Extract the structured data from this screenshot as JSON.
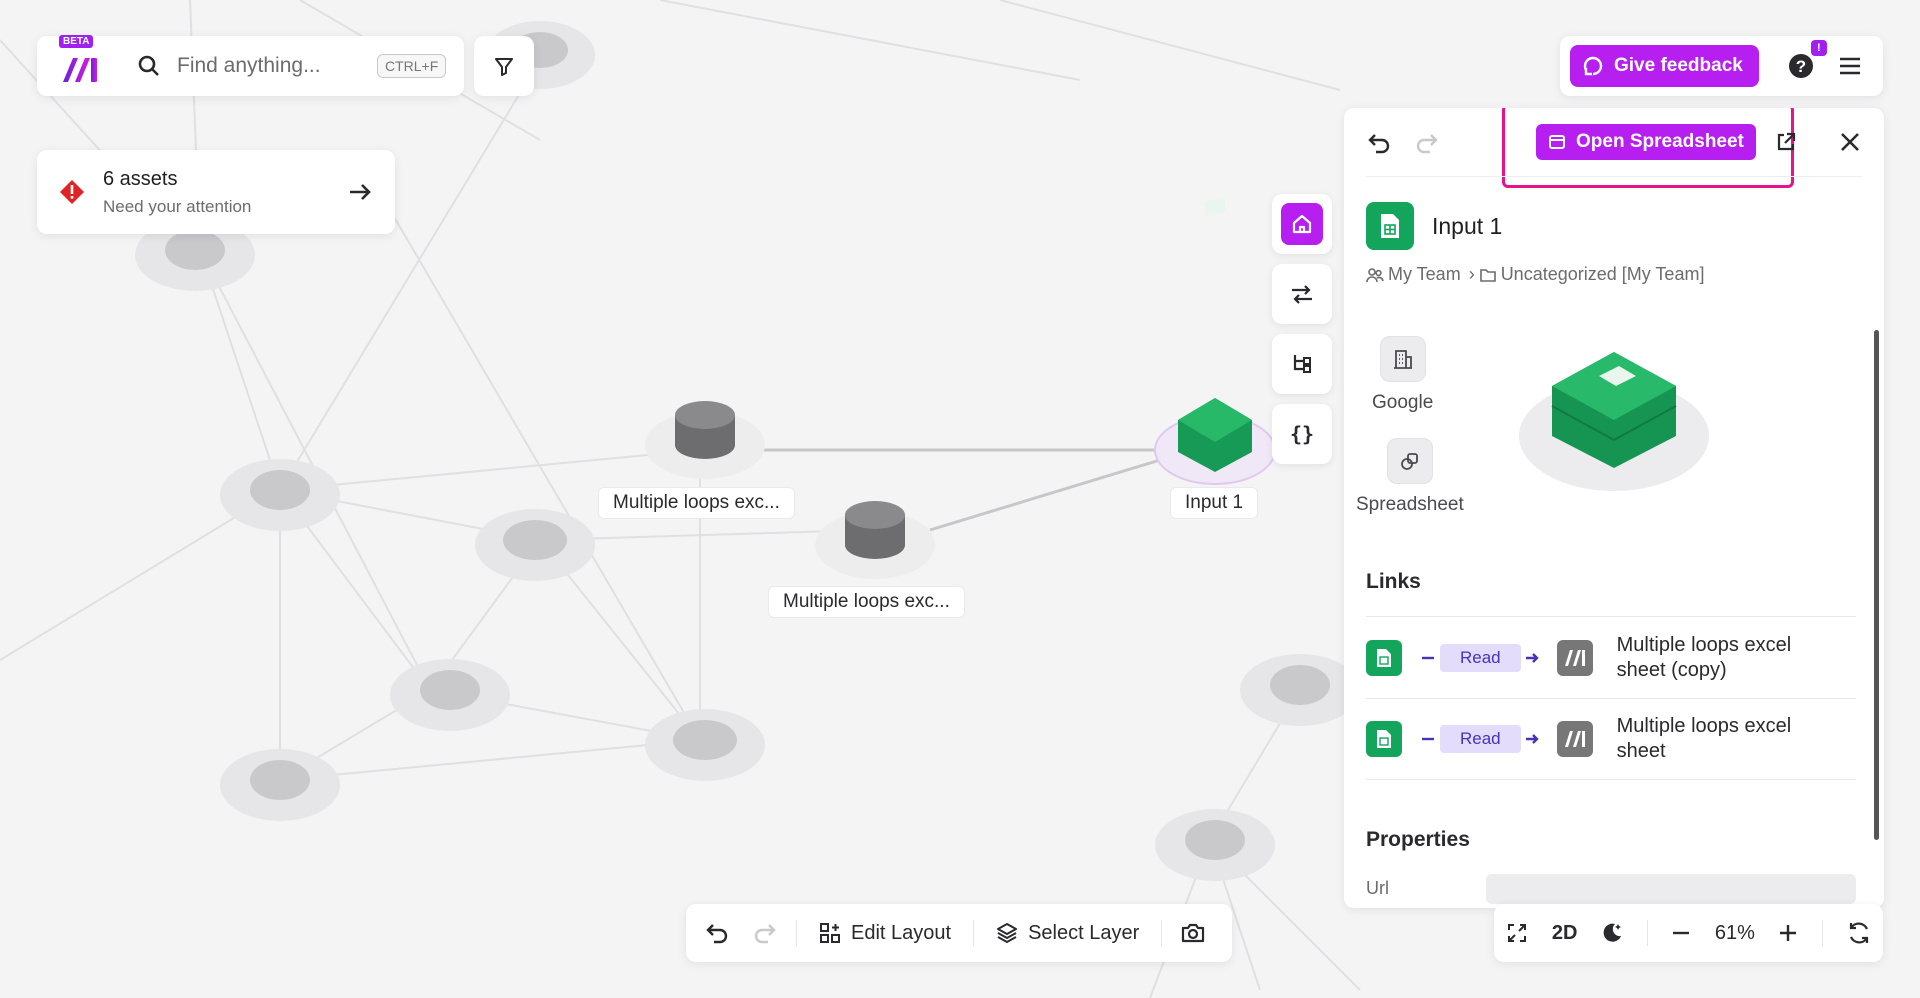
{
  "app": {
    "beta_label": "BETA",
    "search_placeholder": "Find anything...",
    "search_shortcut": "CTRL+F"
  },
  "alert": {
    "title": "6 assets",
    "subtitle": "Need your attention"
  },
  "top_right": {
    "feedback_label": "Give feedback",
    "help_badge": "!"
  },
  "canvas": {
    "node_labels": [
      "Multiple loops exc...",
      "Multiple loops exc...",
      "Input 1"
    ]
  },
  "panel": {
    "open_spreadsheet_label": "Open Spreadsheet",
    "asset_name": "Input 1",
    "breadcrumb": {
      "team": "My Team",
      "folder": "Uncategorized [My Team]"
    },
    "apps": [
      {
        "label": "Google"
      },
      {
        "label": "Spreadsheet"
      }
    ],
    "links_title": "Links",
    "links": [
      {
        "relation": "Read",
        "target": "Multiple loops excel sheet (copy)"
      },
      {
        "relation": "Read",
        "target": "Multiple loops excel sheet"
      }
    ],
    "properties_title": "Properties",
    "property_label": "Url"
  },
  "bottom_toolbar": {
    "edit_layout_label": "Edit Layout",
    "select_layer_label": "Select Layer"
  },
  "zoom_toolbar": {
    "view_mode": "2D",
    "zoom_level": "61%"
  },
  "colors": {
    "accent": "#b61ff0",
    "sheet_green": "#14a55c",
    "highlight": "#e6138a",
    "read_pill": "#e3dcfb"
  }
}
